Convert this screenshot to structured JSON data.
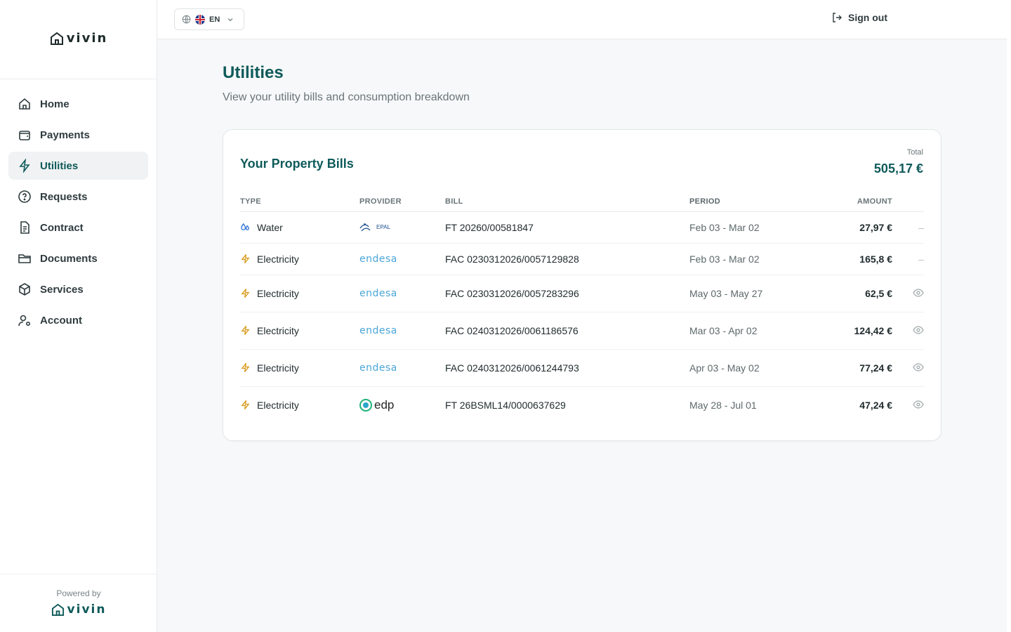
{
  "brand": {
    "name": "vivin"
  },
  "sidebar": {
    "items": [
      {
        "label": "Home",
        "icon": "home-icon",
        "active": false
      },
      {
        "label": "Payments",
        "icon": "wallet-icon",
        "active": false
      },
      {
        "label": "Utilities",
        "icon": "lightning-icon",
        "active": true
      },
      {
        "label": "Requests",
        "icon": "question-circle-icon",
        "active": false
      },
      {
        "label": "Contract",
        "icon": "document-icon",
        "active": false
      },
      {
        "label": "Documents",
        "icon": "folder-icon",
        "active": false
      },
      {
        "label": "Services",
        "icon": "box-icon",
        "active": false
      },
      {
        "label": "Account",
        "icon": "user-settings-icon",
        "active": false
      }
    ],
    "powered_by": "Powered by"
  },
  "topbar": {
    "language": "EN",
    "sign_out": "Sign out"
  },
  "page": {
    "title": "Utilities",
    "subtitle": "View your utility bills and consumption breakdown"
  },
  "bills": {
    "title": "Your Property Bills",
    "total_label": "Total",
    "total_value": "505,17 €",
    "columns": {
      "type": "TYPE",
      "provider": "PROVIDER",
      "bill": "BILL",
      "period": "PERIOD",
      "amount": "AMOUNT"
    },
    "rows": [
      {
        "type": "Water",
        "provider": "EPAL",
        "bill": "FT 20260/00581847",
        "period": "Feb 03 - Mar 02",
        "amount": "27,97 €",
        "action": "–"
      },
      {
        "type": "Electricity",
        "provider": "endesa",
        "bill": "FAC 0230312026/0057129828",
        "period": "Feb 03 - Mar 02",
        "amount": "165,8 €",
        "action": "–"
      },
      {
        "type": "Electricity",
        "provider": "endesa",
        "bill": "FAC 0230312026/0057283296",
        "period": "May 03 - May 27",
        "amount": "62,5 €",
        "action": "view"
      },
      {
        "type": "Electricity",
        "provider": "endesa",
        "bill": "FAC 0240312026/0061186576",
        "period": "Mar 03 - Apr 02",
        "amount": "124,42 €",
        "action": "view"
      },
      {
        "type": "Electricity",
        "provider": "endesa",
        "bill": "FAC 0240312026/0061244793",
        "period": "Apr 03 - May 02",
        "amount": "77,24 €",
        "action": "view"
      },
      {
        "type": "Electricity",
        "provider": "edp",
        "bill": "FT 26BSML14/0000637629",
        "period": "May 28 - Jul 01",
        "amount": "47,24 €",
        "action": "view"
      }
    ]
  },
  "colors": {
    "accent": "#0f5a5a",
    "water_icon": "#2b6fd6",
    "electricity_icon": "#d99a1a"
  }
}
